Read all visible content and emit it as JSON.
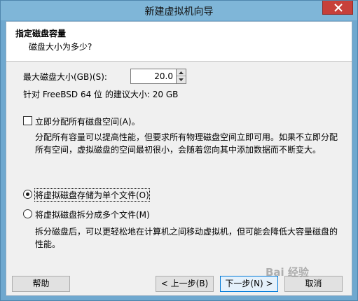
{
  "window": {
    "title": "新建虚拟机向导"
  },
  "header": {
    "title": "指定磁盘容量",
    "subtitle": "磁盘大小为多少?"
  },
  "disk": {
    "size_label": "最大磁盘大小(GB)(S):",
    "size_value": "20.0",
    "recommendation": "针对 FreeBSD 64 位 的建议大小: 20 GB"
  },
  "allocate": {
    "checked": false,
    "label": "立即分配所有磁盘空间(A)。",
    "description_line1": "分配所有容量可以提高性能，但要求所有物理磁盘空间立即可用。如果不立即分配",
    "description_line2": "所有空间，虚拟磁盘的空间最初很小，会随着您向其中添加数据而不断变大。"
  },
  "storage": {
    "option_single": "将虚拟磁盘存储为单个文件(O)",
    "option_multiple": "将虚拟磁盘拆分成多个文件(M)",
    "selected": "single",
    "description_line1": "拆分磁盘后，可以更轻松地在计算机之间移动虚拟机，但可能会降低大容量磁盘的",
    "description_line2": "性能。"
  },
  "buttons": {
    "help": "帮助",
    "back": "< 上一步(B)",
    "next": "下一步(N) >",
    "cancel": "取消"
  },
  "watermark": {
    "text": "Bai 经验"
  },
  "colors": {
    "titlebar": "#7fb6d8",
    "close": "#c7403a",
    "dialog": "#f0f0f0",
    "default_button_border": "#0078d7"
  }
}
